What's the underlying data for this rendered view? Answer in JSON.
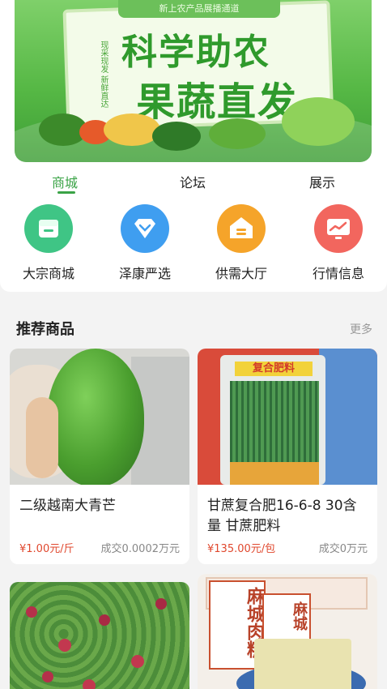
{
  "banner": {
    "tag": "新上农产品展播通道",
    "side_text": "现采现发 新鲜直达",
    "headline_1": "科学助农",
    "headline_2": "果蔬直发"
  },
  "tabs": [
    {
      "label": "商城",
      "active": true
    },
    {
      "label": "论坛",
      "active": false
    },
    {
      "label": "展示",
      "active": false
    }
  ],
  "categories": [
    {
      "label": "大宗商城",
      "icon": "store-icon",
      "color": "#3fc585"
    },
    {
      "label": "泽康严选",
      "icon": "diamond-icon",
      "color": "#3f9ef0"
    },
    {
      "label": "供需大厅",
      "icon": "house-icon",
      "color": "#f5a42a"
    },
    {
      "label": "行情信息",
      "icon": "monitor-chart-icon",
      "color": "#f2665e"
    }
  ],
  "recommend": {
    "title": "推荐商品",
    "more": "更多"
  },
  "products": [
    {
      "name": "二级越南大青芒",
      "price": "¥1.00元/斤",
      "deal": "成交0.0002万元"
    },
    {
      "name": "甘蔗复合肥16-6-8 30含量 甘蔗肥料",
      "price": "¥135.00元/包",
      "deal": "成交0万元"
    },
    {
      "name": "",
      "price": "",
      "deal": ""
    },
    {
      "name": "",
      "price": "",
      "deal": ""
    }
  ],
  "product_images": {
    "fertilizer_bag_text": "复合肥料",
    "cake_text_1": "麻城",
    "cake_text_2": "麻城肉糕"
  },
  "colors": {
    "accent_green": "#3aa346",
    "price_red": "#e0482e"
  }
}
